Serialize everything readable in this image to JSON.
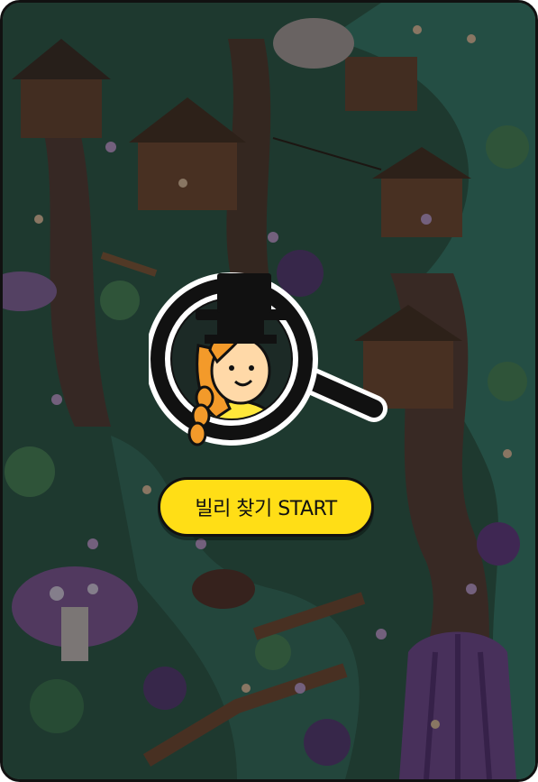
{
  "start_button": {
    "label": "빌리 찾기 START"
  },
  "colors": {
    "accent": "#ffde16",
    "frame_border": "#111111",
    "scene_bg": "#2f5a4a"
  },
  "icons": {
    "magnifier": "magnifying-glass-icon",
    "character": "billy-character-icon"
  }
}
